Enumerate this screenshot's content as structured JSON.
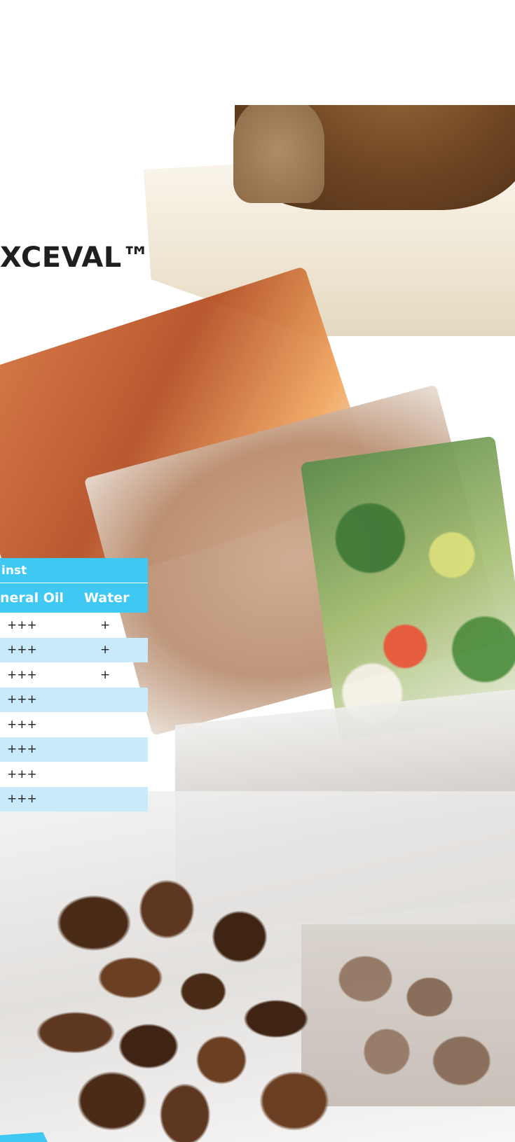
{
  "title": "XCEVAL™",
  "table": {
    "header_group": "inst",
    "columns": [
      "neral Oil",
      "Water"
    ],
    "rows": [
      {
        "oil": "+++",
        "water": "+"
      },
      {
        "oil": "+++",
        "water": "+"
      },
      {
        "oil": "+++",
        "water": "+"
      },
      {
        "oil": "+++",
        "water": ""
      },
      {
        "oil": "+++",
        "water": ""
      },
      {
        "oil": "+++",
        "water": ""
      },
      {
        "oil": "+++",
        "water": ""
      },
      {
        "oil": "+++",
        "water": ""
      }
    ]
  },
  "colors": {
    "header_blue": "#3ec8f2",
    "row_alt_blue": "#c8eafa",
    "title_text": "#1f1f1f"
  }
}
